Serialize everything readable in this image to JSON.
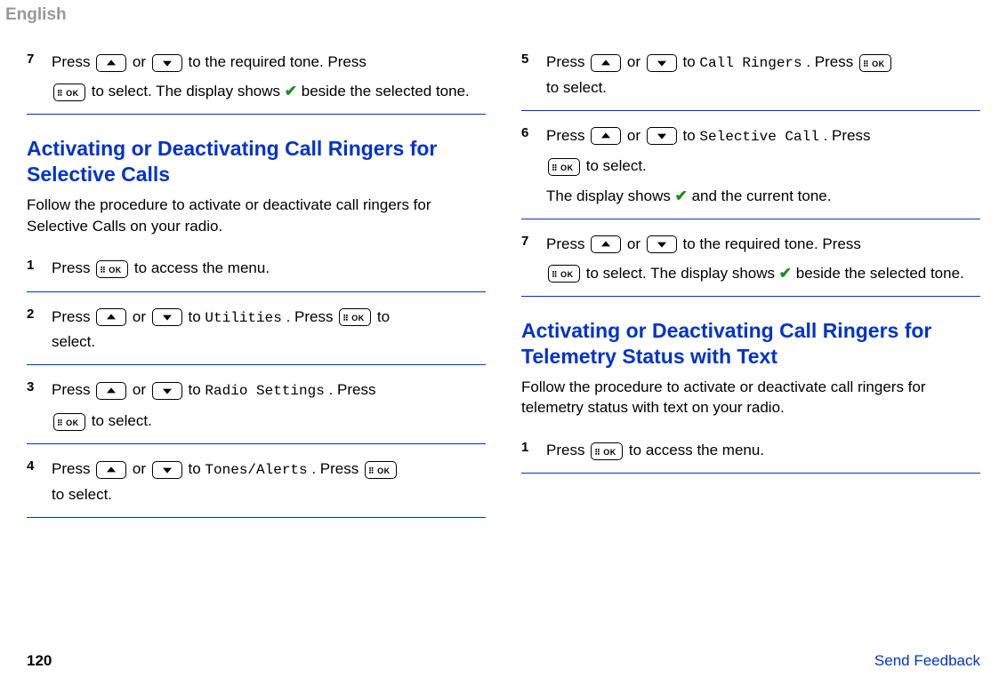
{
  "header": {
    "language": "English"
  },
  "text": {
    "press": "Press ",
    "or": " or ",
    "to": " to ",
    "to_select_period": " to select.",
    "to_select_short": "to select.",
    "press_dot": ". Press ",
    "to_after": " to",
    "access_menu": " to access the menu.",
    "required_tone": " to the required tone. Press",
    "display_check_beside": "beside the selected tone.",
    "display_shows": " to select. The display shows ",
    "display_current": "and the current tone.",
    "the_display_shows": "The display shows "
  },
  "menus": {
    "utilities": "Utilities",
    "radio_settings": "Radio Settings",
    "tones_alerts": "Tones/Alerts",
    "call_ringers": "Call Ringers",
    "selective_call": "Selective Call"
  },
  "left": {
    "section1_title": "Activating or Deactivating Call Ringers for Selective Calls",
    "section1_intro": "Follow the procedure to activate or deactivate call ringers for Selective Calls on your radio.",
    "steps_top": {
      "n7": "7"
    },
    "steps": {
      "n1": "1",
      "n2": "2",
      "n3": "3",
      "n4": "4"
    }
  },
  "right": {
    "steps": {
      "n5": "5",
      "n6": "6",
      "n7": "7"
    },
    "section2_title": "Activating or Deactivating Call Ringers for Telemetry Status with Text",
    "section2_intro": "Follow the procedure to activate or deactivate call ringers for telemetry status with text on your radio.",
    "steps2": {
      "n1": "1"
    }
  },
  "footer": {
    "page": "120",
    "feedback": "Send Feedback"
  }
}
